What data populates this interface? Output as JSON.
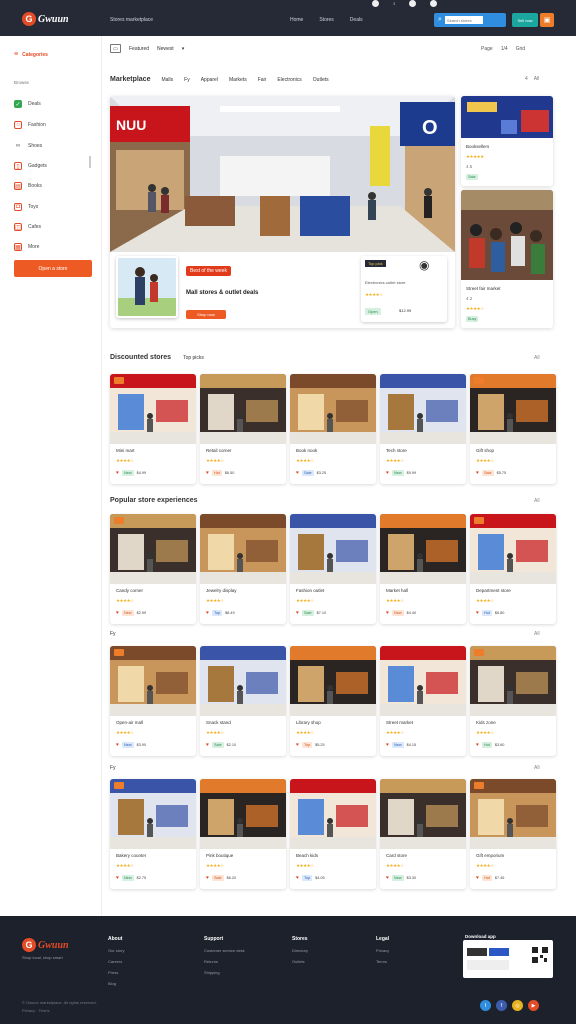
{
  "brand": {
    "name": "Gwuun",
    "tagline": "Community marketplace",
    "accent": "#e44b27"
  },
  "topbar": {
    "tagline": "Stores marketplace",
    "links": [
      "Home",
      "Stores",
      "Deals"
    ],
    "search_placeholder": "Search stores",
    "teal_label": "Sell now",
    "status_count": "3"
  },
  "sidebar": {
    "brand_label": "Categories",
    "section_label": "Browse",
    "items": [
      {
        "label": "Deals",
        "icon": "tag-icon",
        "color": "#2fa84f"
      },
      {
        "label": "Fashion",
        "icon": "shirt-icon",
        "color": "#e44b27"
      },
      {
        "label": "Shoes",
        "icon": "link-icon",
        "color": "#555555"
      },
      {
        "label": "Gadgets",
        "icon": "phone-icon",
        "color": "#e44b27"
      },
      {
        "label": "Books",
        "icon": "book-icon",
        "color": "#e44b27"
      },
      {
        "label": "Toys",
        "icon": "gift-icon",
        "color": "#e44b27"
      },
      {
        "label": "Cafes",
        "icon": "cup-icon",
        "color": "#e44b27"
      },
      {
        "label": "More",
        "icon": "grid-icon",
        "color": "#e44b27"
      }
    ],
    "cta": "Open a store"
  },
  "toolbar": {
    "view_label": "Featured",
    "sort_label": "Newest",
    "right": [
      "Page",
      "1/4",
      "Grid"
    ]
  },
  "categories": {
    "title": "Marketplace",
    "items": [
      "Malls",
      "Fy",
      "Apparel",
      "Markets",
      "Fair",
      "Electronics",
      "Outlets"
    ],
    "right": [
      "4",
      "All"
    ]
  },
  "hero": {
    "badge": "Best of the week",
    "title": "Mall stores & outlet deals",
    "cta": "Shop now",
    "card": {
      "label": "Top pick",
      "sub": "Electronics outlet store",
      "tag": "Open",
      "price": "$12.99"
    }
  },
  "side_cards": [
    {
      "title": "Booksellers",
      "rating": "4.5",
      "tag": "Sale"
    },
    {
      "title": "Street fair market",
      "rating": "4.2",
      "tag": "Busy"
    }
  ],
  "sections": [
    {
      "title": "Discounted stores",
      "sub": "Top picks",
      "more": "All",
      "cards": [
        {
          "title": "Mini mart",
          "price": "$4.99",
          "tag": "New"
        },
        {
          "title": "Retail corner",
          "price": "$6.50",
          "tag": "Hot"
        },
        {
          "title": "Book nook",
          "price": "$3.25",
          "tag": "Sale"
        },
        {
          "title": "Tech store",
          "price": "$9.99",
          "tag": "New"
        },
        {
          "title": "Gift shop",
          "price": "$5.75",
          "tag": "Sale"
        }
      ]
    },
    {
      "title": "Popular store experiences",
      "sub": "",
      "more": "All",
      "cards": [
        {
          "title": "Candy corner",
          "price": "$2.99",
          "tag": "New"
        },
        {
          "title": "Jewelry display",
          "price": "$8.49",
          "tag": "Top"
        },
        {
          "title": "Fashion outlet",
          "price": "$7.10",
          "tag": "Sale"
        },
        {
          "title": "Market hall",
          "price": "$4.40",
          "tag": "New"
        },
        {
          "title": "Department store",
          "price": "$6.80",
          "tag": "Hot"
        }
      ]
    },
    {
      "title": "Fy",
      "sub": "",
      "more": "All",
      "cards": [
        {
          "title": "Open-air mall",
          "price": "$3.90",
          "tag": "New"
        },
        {
          "title": "Snack stand",
          "price": "$2.10",
          "tag": "Sale"
        },
        {
          "title": "Library shop",
          "price": "$5.25",
          "tag": "Top"
        },
        {
          "title": "Street market",
          "price": "$4.15",
          "tag": "New"
        },
        {
          "title": "Kids zone",
          "price": "$3.60",
          "tag": "Hot"
        }
      ]
    },
    {
      "title": "Fy",
      "sub": "",
      "more": "All",
      "cards": [
        {
          "title": "Bakery counter",
          "price": "$2.75",
          "tag": "New"
        },
        {
          "title": "Pink boutique",
          "price": "$6.20",
          "tag": "Sale"
        },
        {
          "title": "Beach kids",
          "price": "$4.05",
          "tag": "Top"
        },
        {
          "title": "Card store",
          "price": "$3.30",
          "tag": "New"
        },
        {
          "title": "Gift emporium",
          "price": "$7.45",
          "tag": "Hot"
        }
      ]
    }
  ],
  "footer": {
    "tagline": "Shop local, shop smart",
    "columns": [
      {
        "heading": "About",
        "links": [
          "Our story",
          "Careers",
          "Press",
          "Blog"
        ]
      },
      {
        "heading": "Support",
        "links": [
          "Customer service desk",
          "Returns",
          "Shipping"
        ]
      },
      {
        "heading": "Stores",
        "links": [
          "Directory",
          "Outlets"
        ]
      },
      {
        "heading": "Legal",
        "links": [
          "Privacy",
          "Terms"
        ]
      }
    ],
    "app_heading": "Download app",
    "copyright": "© Gwuun marketplace. All rights reserved.",
    "sub": "Privacy · Terms"
  }
}
